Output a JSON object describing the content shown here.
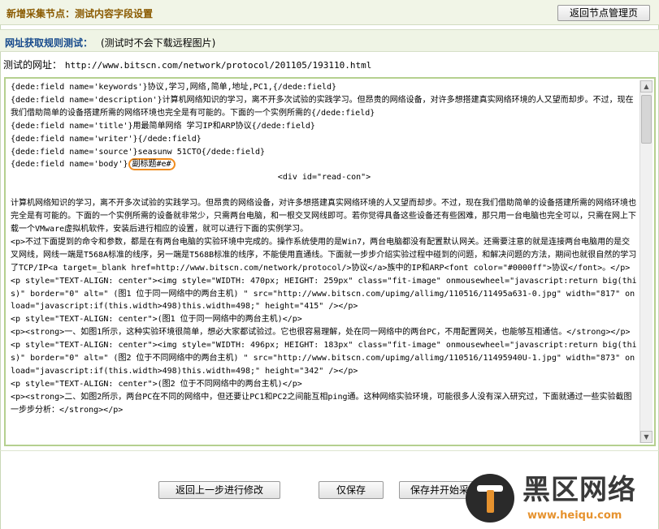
{
  "header": {
    "title": "新增采集节点：测试内容字段设置",
    "back_button": "返回节点管理页"
  },
  "rule_test": {
    "label": "网址获取规则测试：",
    "note": "(测试时不会下载远程图片)"
  },
  "test_url": {
    "label": "测试的网址：",
    "value": "http://www.bitscn.com/network/protocol/201105/193110.html"
  },
  "content": {
    "lines": [
      "{dede:field name='keywords'}协议,学习,网络,简单,地址,PC1,{/dede:field}",
      "{dede:field name='description'}计算机网络知识的学习，离不开多次试验的实践学习。但昂贵的网络设备，对许多想搭建真实网络环境的人又望而却步。不过，现在我们借助简单的设备搭建所需的网络环境也完全是有可能的。下面的一个实例所需的{/dede:field}",
      "{dede:field name='title'}用最简单网络 学习IP和ARP协议{/dede:field}",
      "{dede:field name='writer'}{/dede:field}",
      "{dede:field name='source'}seasunw  51CTO{/dede:field}",
      "{dede:field name='body'}",
      "<div id=\"read-con\">",
      "",
      "计算机网络知识的学习，离不开多次试验的实践学习。但昂贵的网络设备，对许多想搭建真实网络环境的人又望而却步。不过，现在我们借助简单的设备搭建所需的网络环境也完全是有可能的。下面的一个实例所需的设备就非常少，只需两台电脑，和一根交叉网线即可。若你觉得具备这些设备还有些困难，那只用一台电脑也完全可以，只需在网上下载一个VMware虚拟机软件，安装后进行相应的设置，就可以进行下面的实例学习。",
      "<p>不过下面提到的命令和参数，都是在有两台电脑的实验环境中完成的。操作系统使用的是Win7，两台电脑都没有配置默认网关。还需要注意的就是连接两台电脑用的是交叉网线，网线一端是T568A标准的线序，另一端是T568B标准的线序，不能使用直通线。下面就一步步介绍实验过程中碰到的问题，和解决问题的方法，期间也就很自然的学习了TCP/IP<a target=_blank href=http://www.bitscn.com/network/protocol/>协议</a>族中的IP和ARP<font color=\"#0000ff\">协议</font>。</p>",
      "<p style=\"TEXT-ALIGN: center\"><img style=\"WIDTH: 470px; HEIGHT: 259px\" class=\"fit-image\" onmousewheel=\"javascript:return big(this)\" border=\"0\" alt=\" (图1 位于同一网络中的两台主机) \" src=\"http://www.bitscn.com/upimg/allimg/110516/11495a631-0.jpg\" width=\"817\" onload=\"javascript:if(this.width>498)this.width=498;\" height=\"415\" /></p>",
      "<p style=\"TEXT-ALIGN: center\">(图1 位于同一网络中的两台主机)</p>",
      "<p><strong>一、如图1所示，这种实验环境很简单，想必大家都试验过。它也很容易理解，处在同一网络中的两台PC，不用配置网关，也能够互相通信。</strong></p>",
      "<p style=\"TEXT-ALIGN: center\"><img style=\"WIDTH: 496px; HEIGHT: 183px\" class=\"fit-image\" onmousewheel=\"javascript:return big(this)\" border=\"0\" alt=\" (图2 位于不同网络中的两台主机) \" src=\"http://www.bitscn.com/upimg/allimg/110516/11495940U-1.jpg\" width=\"873\" onload=\"javascript:if(this.width>498)this.width=498;\" height=\"342\" /></p>",
      "<p style=\"TEXT-ALIGN: center\">(图2 位于不同网络中的两台主机)</p>",
      "<p><strong>二、如图2所示，两台PC在不同的网络中，但还要让PC1和PC2之间能互相ping通。这种网络实验环境，可能很多人没有深入研究过，下面就通过一些实验截图一步步分析：</strong></p>"
    ],
    "highlight_text": "副标题#e#"
  },
  "buttons": {
    "back_step": "返回上一步进行修改",
    "save_only": "仅保存",
    "save_start": "保存并开始采集"
  },
  "watermark": {
    "title": "黑区网络",
    "url": "www.heiqu.com"
  },
  "colors": {
    "title": "#8a5a00",
    "rule_label": "#174a8c",
    "content_border": "#b5d08f",
    "highlight": "#f08c1e"
  }
}
